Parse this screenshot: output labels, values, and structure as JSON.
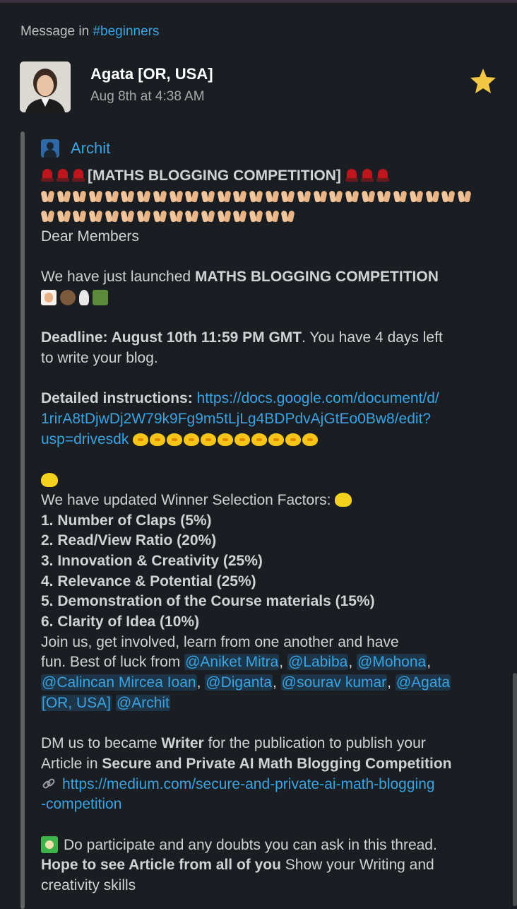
{
  "header": {
    "context_prefix": "Message in",
    "channel": "#beginners"
  },
  "message": {
    "author": "Agata [OR, USA]",
    "timestamp": "Aug 8th at 4:38 AM",
    "starred": true,
    "star_color": "#f2c744"
  },
  "shared": {
    "sender": "Archit",
    "title": "[MATHS BLOGGING COMPETITION]",
    "greeting": "Dear Members",
    "launch_prefix": "We have just launched",
    "launch_bold": "MATHS BLOGGING COMPETITION",
    "deadline_bold": "Deadline: August 10th 11:59 PM GMT",
    "deadline_rest_1": ". You have 4 days left",
    "deadline_rest_2": "to write your blog.",
    "instructions_label": "Detailed instructions:",
    "instructions_url_1": "https://docs.google.com/document/d/",
    "instructions_url_2": "1rirA8tDjwDj2W79k9Fg9m5tLjLg4BDPdvAjGtEo0Bw8/edit?",
    "instructions_url_3": "usp=drivesdk",
    "factors_intro": "We have updated Winner Selection Factors:",
    "factors": [
      "1. Number of Claps (5%)",
      "2. Read/View Ratio (20%)",
      "3. Innovation & Creativity (25%)",
      "4. Relevance & Potential (25%)",
      "5. Demonstration of the Course materials (15%)",
      "6. Clarity of Idea (10%)"
    ],
    "join_1": "Join us, get involved, learn from one another and have",
    "join_2": "fun. Best of luck from",
    "mentions": [
      "@Aniket Mitra",
      "@Labiba",
      "@Mohona",
      "@Calincan Mircea Ioan",
      "@Diganta",
      "@sourav kumar",
      "@Agata [OR, USA]",
      "@Archit"
    ],
    "dm_prefix": "DM us to became",
    "dm_bold": "Writer",
    "dm_rest": "for the publication to publish your",
    "article_prefix": "Article in",
    "article_bold": "Secure and Private AI Math Blogging Competition",
    "medium_url_1": "https://medium.com/secure-and-private-ai-math-blogging",
    "medium_url_2": "-competition",
    "participate": "Do participate and any doubts you can ask in this thread.",
    "hope_bold": "Hope to see Article from all of you",
    "hope_rest": "Show your Writing and",
    "creativity": "creativity skills"
  }
}
